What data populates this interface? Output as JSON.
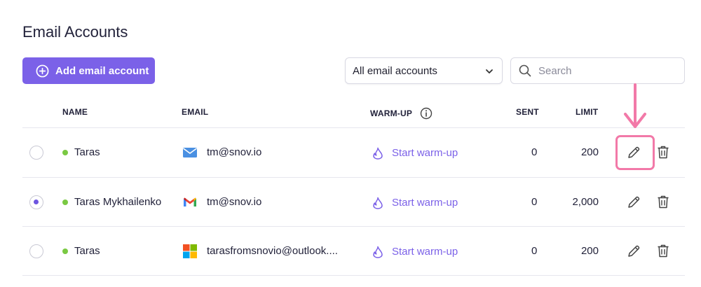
{
  "page": {
    "title": "Email Accounts"
  },
  "toolbar": {
    "add_label": "Add email account",
    "filter_value": "All email accounts",
    "search_placeholder": "Search"
  },
  "table": {
    "headers": {
      "name": "NAME",
      "email": "EMAIL",
      "warmup": "WARM-UP",
      "sent": "SENT",
      "limit": "LIMIT"
    },
    "rows": [
      {
        "name": "Taras",
        "email": "tm@snov.io",
        "provider": "mail-envelope-icon",
        "warmup": "Start warm-up",
        "sent": "0",
        "limit": "200",
        "selected": false,
        "status": "active"
      },
      {
        "name": "Taras Mykhailenko",
        "email": "tm@snov.io",
        "provider": "gmail-icon",
        "warmup": "Start warm-up",
        "sent": "0",
        "limit": "2,000",
        "selected": true,
        "status": "active"
      },
      {
        "name": "Taras",
        "email": "tarasfromsnovio@outlook....",
        "provider": "microsoft-icon",
        "warmup": "Start warm-up",
        "sent": "0",
        "limit": "200",
        "selected": false,
        "status": "active"
      }
    ]
  },
  "colors": {
    "accent": "#7b61e8",
    "status_active": "#7ac943",
    "highlight": "#f279a8"
  }
}
